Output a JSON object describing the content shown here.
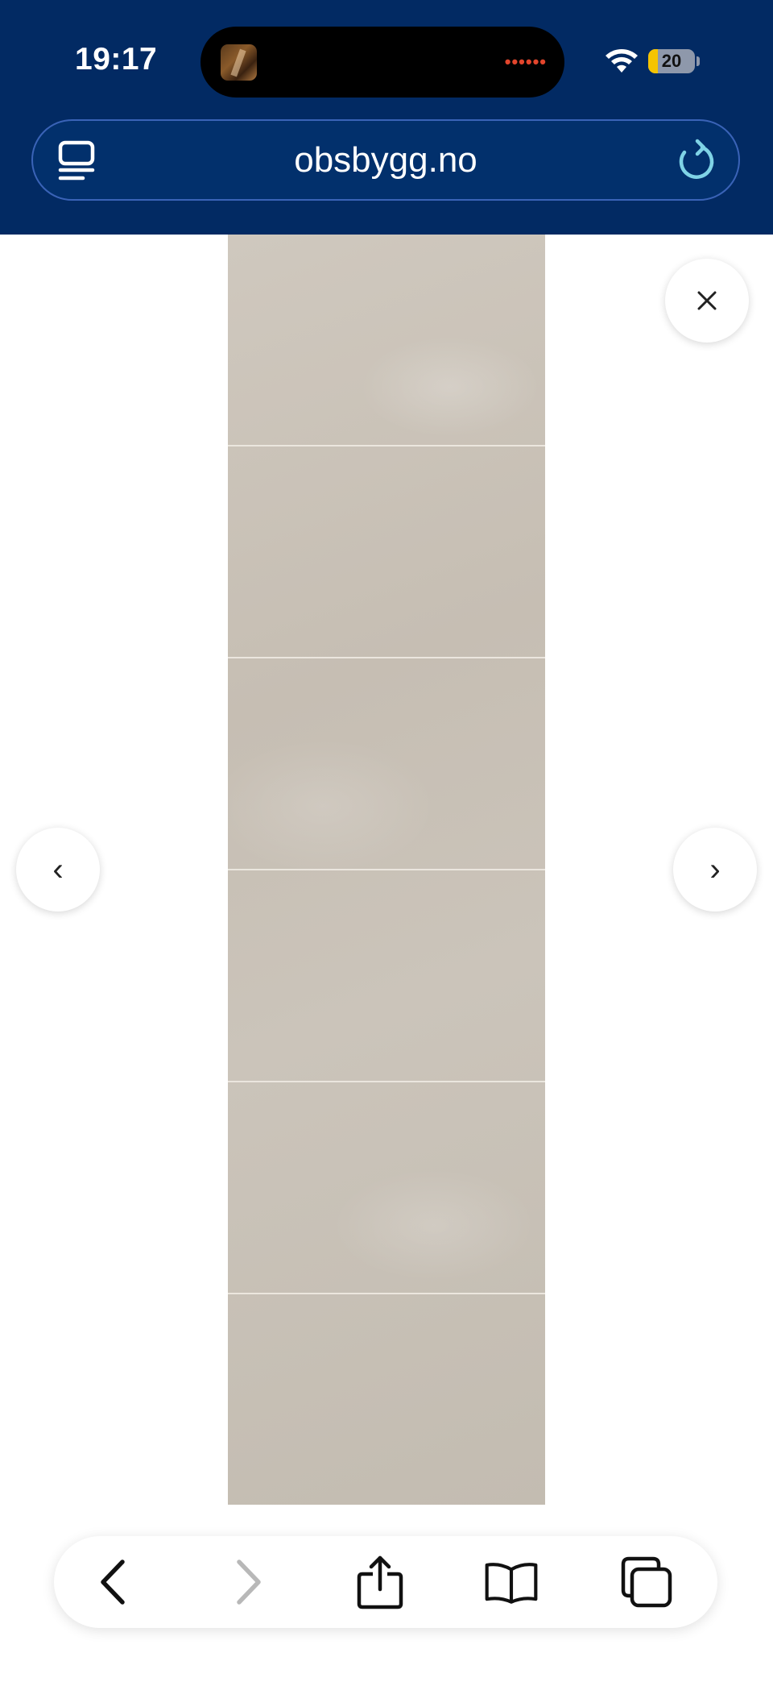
{
  "status_bar": {
    "time": "19:17",
    "battery_level": "20",
    "battery_fraction": 0.2,
    "icons": [
      "wifi-icon",
      "battery-icon"
    ],
    "live_activity_indicator": "••••••"
  },
  "browser": {
    "url": "obsbygg.no",
    "left_icon": "reader-mode-icon",
    "right_icon": "reload-icon",
    "chrome_color": "#022a63"
  },
  "gallery": {
    "image_description_icon": "product-image",
    "tile_rows": 6,
    "close_glyph": "✕",
    "prev_glyph": "‹",
    "next_glyph": "›"
  },
  "toolbar": {
    "buttons": [
      {
        "name": "back-icon",
        "enabled": true
      },
      {
        "name": "forward-icon",
        "enabled": false
      },
      {
        "name": "share-icon",
        "enabled": true
      },
      {
        "name": "bookmarks-icon",
        "enabled": true
      },
      {
        "name": "tabs-icon",
        "enabled": true
      }
    ]
  }
}
